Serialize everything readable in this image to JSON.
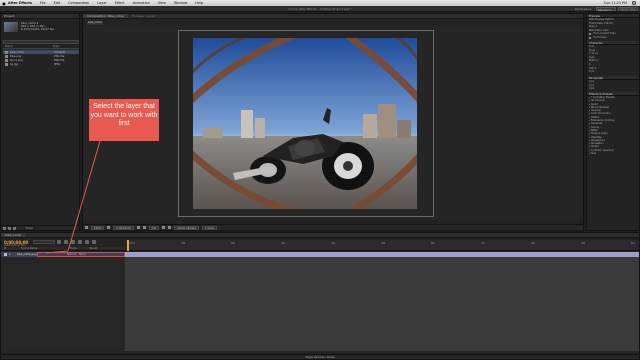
{
  "menubar": {
    "apple": "",
    "items": [
      "After Effects",
      "File",
      "Edit",
      "Composition",
      "Layer",
      "Effect",
      "Animation",
      "View",
      "Window",
      "Help"
    ],
    "clock": "Sun 11:23 PM",
    "colors": {
      "bg": "#d9d9d9"
    }
  },
  "titlebar": {
    "title": "Adobe After Effects - Untitled Project.aep *",
    "workspace_label": "Workspace:",
    "workspace_value": "Standard",
    "search_placeholder": "Search Help"
  },
  "project": {
    "tab": "Project",
    "info": [
      "bike_comp ▾",
      "640 x 360 (1.00)",
      "Δ 0;00;10;00, 29.97 fps"
    ],
    "columns": [
      "Name",
      "Type"
    ],
    "items": [
      {
        "name": "bike_comp",
        "type": "Composi..."
      },
      {
        "name": "Bike.png",
        "type": "PNG file"
      },
      {
        "name": "fence.png",
        "type": "PNG file"
      },
      {
        "name": "bg.jpg",
        "type": "JPEG"
      }
    ],
    "bpc": "8 bpc"
  },
  "composition": {
    "tabs": [
      "Composition: bike_comp",
      "Footage: (none)"
    ],
    "crumb": "bike_comp",
    "zoom": "100%",
    "timecode": "0;00;00;00",
    "quality": "Full",
    "camera": "Active Camera",
    "views": "1 View"
  },
  "right_panel": {
    "info_tab": "Preview",
    "preview_rows": [
      "RAM Preview Options",
      "Frame Rate: (29.97)",
      "Skip: 0",
      "Resolution: Auto",
      "From Current Time",
      "Full Screen"
    ],
    "character_tab": "Character",
    "character_rows": [
      "Font",
      "Style",
      "T 12 px",
      "Auto",
      "Metrics",
      "0",
      "100 %",
      "0 px"
    ],
    "paragraph_tab": "Paragraph",
    "paragraph_rows": [
      "0 px",
      "0 px",
      "0 px"
    ],
    "effects_tab": "Effects & Presets",
    "effects": [
      "* Animation Presets",
      "3D Channel",
      "Audio",
      "Blur & Sharpen",
      "Channel",
      "Color Correction",
      "Distort",
      "Expression Controls",
      "Generate",
      "Keying",
      "Matte",
      "Noise & Grain",
      "Obsolete",
      "Perspective",
      "Simulation",
      "Stylize",
      "Synthetic Aperture",
      "Text"
    ]
  },
  "timeline": {
    "tab": "bike_comp",
    "time": "0;00;00;00",
    "fps": "00000 (29.97 fps)",
    "columns": [
      "#",
      "Source Name",
      "Mode",
      "Parent"
    ],
    "ruler_ticks": [
      "0:00s",
      "01s",
      "02s",
      "03s",
      "04s",
      "05s",
      "06s",
      "07s",
      "08s",
      "09s",
      "10s"
    ],
    "layer": {
      "num": "1",
      "name": "bike_comp.png",
      "mode": "Normal",
      "parent": "None"
    },
    "footer": "Toggle Switches / Modes"
  },
  "annotation": {
    "text": "Select the layer that you want to work with first",
    "color": "#e85a50"
  }
}
